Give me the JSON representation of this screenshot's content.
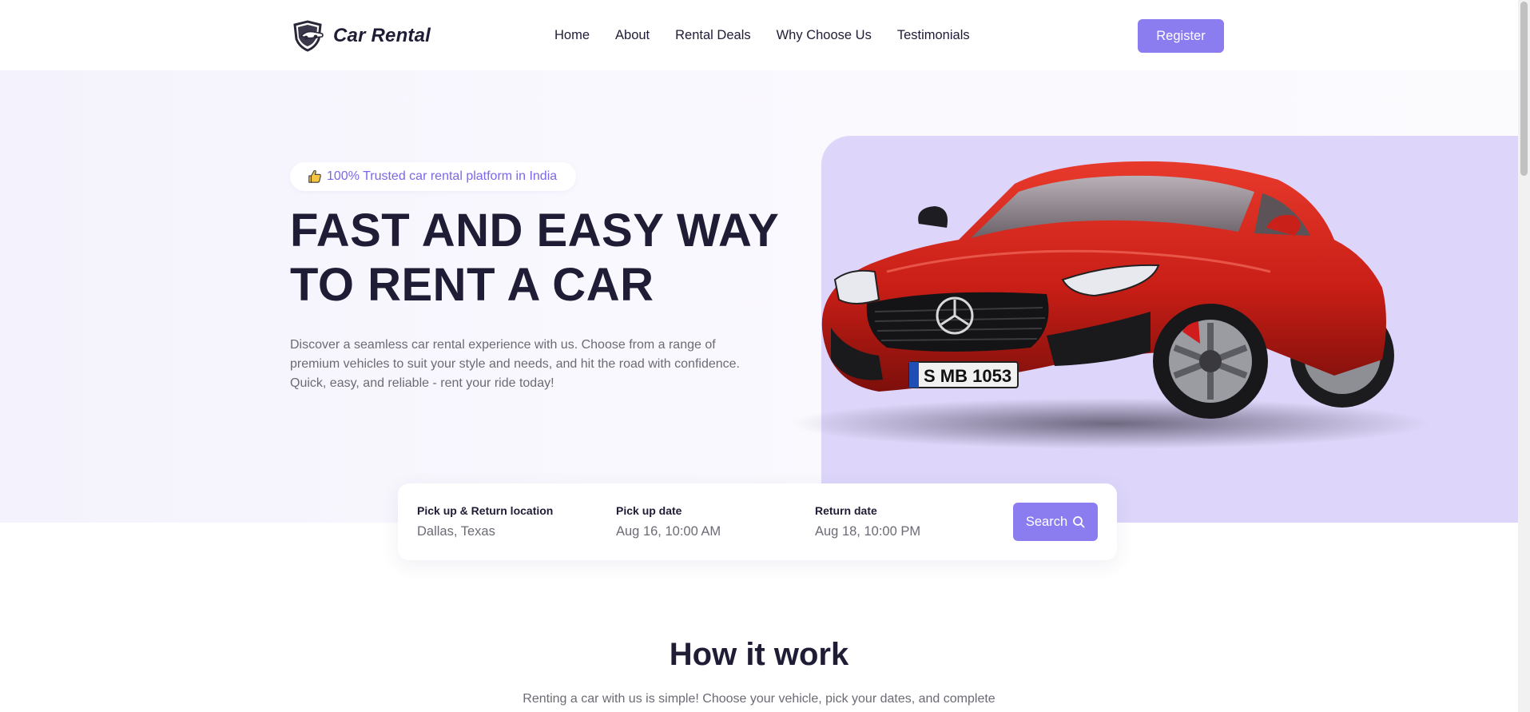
{
  "nav": {
    "brand": "Car Rental",
    "logo_icon": "car-shield-logo",
    "menu": [
      {
        "label": "Home"
      },
      {
        "label": "About"
      },
      {
        "label": "Rental Deals"
      },
      {
        "label": "Why Choose Us"
      },
      {
        "label": "Testimonials"
      }
    ],
    "register_label": "Register"
  },
  "hero": {
    "badge_icon": "thumbs-up-icon",
    "badge_text": "100% Trusted car rental platform in India",
    "headline_line1": "FAST AND EASY WAY",
    "headline_line2": "TO RENT A CAR",
    "description": "Discover a seamless car rental experience with us. Choose from a range of premium vehicles to suit your style and needs, and hit the road with confidence. Quick, easy, and reliable - rent your ride today!",
    "car_plate": "S MB 1053"
  },
  "search": {
    "location_label": "Pick up & Return location",
    "location_value": "Dallas, Texas",
    "pickup_label": "Pick up date",
    "pickup_value": "Aug 16, 10:00 AM",
    "return_label": "Return date",
    "return_value": "Aug 18, 10:00 PM",
    "button_label": "Search",
    "button_icon": "search-icon"
  },
  "how_it_works": {
    "title": "How it work",
    "description": "Renting a car with us is simple! Choose your vehicle, pick your dates, and complete"
  },
  "colors": {
    "accent": "#8b7cf0",
    "badge_text": "#7b68e8",
    "hero_panel": "#ddd6fa",
    "heading": "#1f1d36"
  }
}
